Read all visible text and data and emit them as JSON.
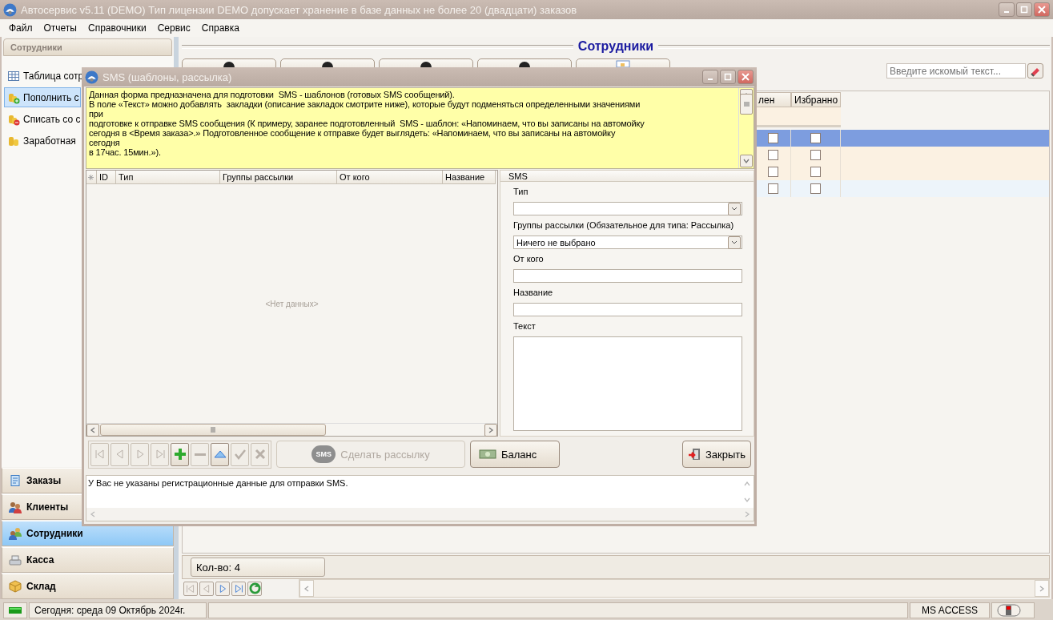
{
  "window": {
    "title": "Автосервис v5.11 (DEMO) Тип лицензии DEMO допускает хранение в базе данных не более 20 (двадцати) заказов"
  },
  "menu": [
    "Файл",
    "Отчеты",
    "Справочники",
    "Сервис",
    "Справка"
  ],
  "sidebar": {
    "title": "Сотрудники",
    "items": [
      {
        "label": "Таблица сотр",
        "kind": "table",
        "selected": false
      },
      {
        "label": "Пополнить с",
        "kind": "add",
        "selected": true
      },
      {
        "label": "Списать со с",
        "kind": "remove",
        "selected": false
      },
      {
        "label": "Заработная",
        "kind": "coins",
        "selected": false
      }
    ],
    "nav": [
      {
        "label": "Заказы",
        "kind": "orders",
        "selected": false
      },
      {
        "label": "Клиенты",
        "kind": "clients",
        "selected": false
      },
      {
        "label": "Сотрудники",
        "kind": "staff",
        "selected": true
      },
      {
        "label": "Касса",
        "kind": "cash",
        "selected": false
      },
      {
        "label": "Склад",
        "kind": "stock",
        "selected": false
      }
    ]
  },
  "content": {
    "title": "Сотрудники",
    "search": {
      "placeholder": "Введите искомый текст..."
    },
    "table": {
      "columns": [
        "лен",
        "Избранно"
      ],
      "rows": [
        {
          "selected": true,
          "checks": [
            false,
            false
          ]
        },
        {
          "selected": false,
          "checks": [
            false,
            false
          ]
        },
        {
          "selected": false,
          "checks": [
            false,
            false
          ]
        },
        {
          "selected": false,
          "checks": [
            false,
            false
          ]
        }
      ]
    },
    "count": "Кол-во: 4"
  },
  "status_bar": {
    "date": "Сегодня: среда 09 Октябрь 2024г.",
    "database": "MS ACCESS"
  },
  "dialog": {
    "title": "SMS (шаблоны, рассылка)",
    "info_lines": [
      "Данная форма предназначена для подготовки  SMS - шаблонов (готовых SMS сообщений).",
      "В поле «Текст» можно добавлять  закладки (описание закладок смотрите ниже), которые будут подменяться определенными значениями",
      "при",
      "подготовке к отправке SMS сообщения (К примеру, заранее подготовленный  SMS - шаблон: «Напоминаем, что вы записаны на автомойку",
      "сегодня в <Время заказа>.» Подготовленное сообщение к отправке будет выглядеть: «Напоминаем, что вы записаны на автомойку",
      "сегодня",
      "в 17час. 15мин.»)."
    ],
    "grid": {
      "columns": [
        "ID",
        "Тип",
        "Группы рассылки",
        "От кого",
        "Название"
      ],
      "empty_text": "<Нет данных>"
    },
    "form": {
      "title": "SMS",
      "fields": [
        {
          "label": "Тип",
          "kind": "combo"
        },
        {
          "label": "Группы рассылки (Обязательное для типа: Рассылка)",
          "kind": "combo",
          "value": "Ничего не выбрано"
        },
        {
          "label": "От кого",
          "kind": "text"
        },
        {
          "label": "Название",
          "kind": "text"
        },
        {
          "label": "Текст",
          "kind": "memo"
        }
      ]
    },
    "nav_buttons": [
      {
        "kind": "first",
        "disabled": true
      },
      {
        "kind": "prev",
        "disabled": true
      },
      {
        "kind": "next",
        "disabled": true
      },
      {
        "kind": "last",
        "disabled": true
      },
      {
        "kind": "add",
        "disabled": false
      },
      {
        "kind": "remove",
        "disabled": true
      },
      {
        "kind": "up",
        "disabled": false
      },
      {
        "kind": "ok",
        "disabled": true
      },
      {
        "kind": "cancel",
        "disabled": true
      }
    ],
    "send_button": {
      "label": "Сделать рассылку",
      "badge": "SMS",
      "disabled": true
    },
    "balance_button": {
      "label": "Баланс"
    },
    "close_button": {
      "label": "Закрыть"
    },
    "message": "У  Вас не указаны регистрационные данные для отправки SMS."
  }
}
